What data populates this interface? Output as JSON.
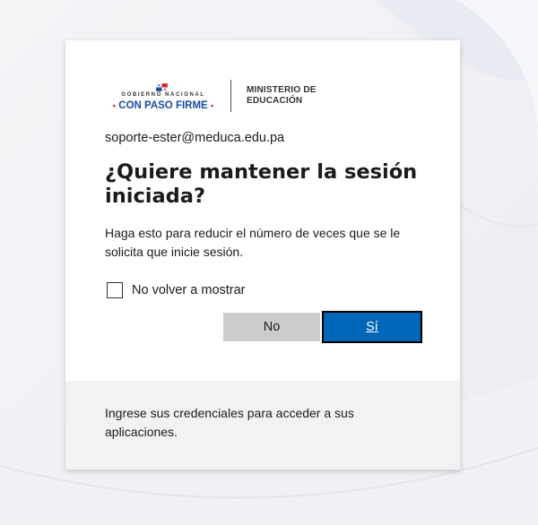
{
  "logo": {
    "gobierno_text": "GOBIERNO NACIONAL",
    "con_paso_firme_text": "CON PASO FIRME",
    "ministerio_line1": "MINISTERIO DE",
    "ministerio_line2": "EDUCACIÓN"
  },
  "identity": {
    "email": "soporte-ester@meduca.edu.pa"
  },
  "prompt": {
    "title": "¿Quiere mantener la sesión iniciada?",
    "description": "Haga esto para reducir el número de veces que se le solicita que inicie sesión.",
    "checkbox_label": "No volver a mostrar",
    "checkbox_checked": false
  },
  "buttons": {
    "no_label": "No",
    "yes_label": "Sí"
  },
  "footer": {
    "text": "Ingrese sus credenciales para acceder a sus aplicaciones."
  },
  "colors": {
    "primary_button": "#0067b8",
    "secondary_button": "#cccccc",
    "footer_background": "#f2f2f2",
    "brand_blue": "#1a4a9e",
    "brand_red": "#d32027"
  }
}
